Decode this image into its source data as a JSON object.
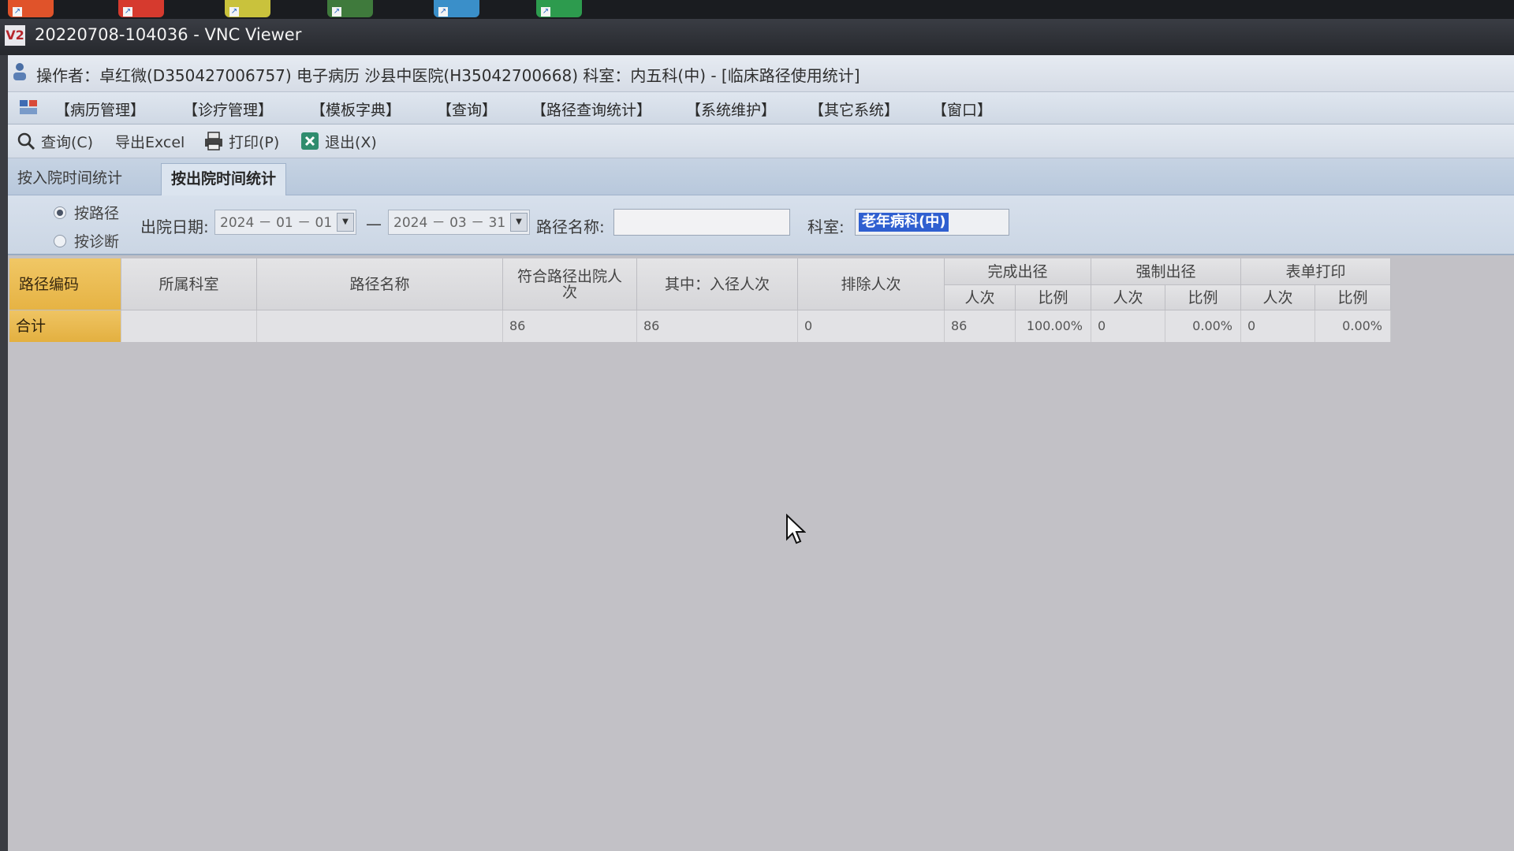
{
  "vnc": {
    "title": "20220708-104036 - VNC Viewer",
    "logo": "V2"
  },
  "info": {
    "text": "操作者：卓红微(D350427006757) 电子病历 沙县中医院(H35042700668) 科室：内五科(中) - [临床路径使用统计]"
  },
  "menu": {
    "items": [
      "【病历管理】",
      "【诊疗管理】",
      "【模板字典】",
      "【查询】",
      "【路径查询统计】",
      "【系统维护】",
      "【其它系统】",
      "【窗口】"
    ]
  },
  "toolbar": {
    "query": "查询(C)",
    "export": "导出Excel",
    "print": "打印(P)",
    "exit": "退出(X)"
  },
  "tabs": {
    "admission": "按入院时间统计",
    "discharge": "按出院时间统计"
  },
  "filter": {
    "by_path": "按路径",
    "by_diagnosis": "按诊断",
    "date_label": "出院日期:",
    "date_from": "2024 － 01 － 01",
    "dash": "—",
    "date_to": "2024 － 03 － 31",
    "path_name_label": "路径名称:",
    "path_name_value": "",
    "dept_label": "科室:",
    "dept_value": "老年病科(中)"
  },
  "table": {
    "headers": {
      "code": "路径编码",
      "dept": "所属科室",
      "name": "路径名称",
      "eligible": "符合路径出院人次",
      "entered": "其中：入径人次",
      "excluded": "排除人次",
      "completed": "完成出径",
      "forced": "强制出径",
      "form_print": "表单打印",
      "count": "人次",
      "ratio": "比例"
    },
    "total_row": {
      "label": "合计",
      "dept": "",
      "name": "",
      "eligible": "86",
      "entered": "86",
      "excluded": "0",
      "completed_count": "86",
      "completed_ratio": "100.00%",
      "forced_count": "0",
      "forced_ratio": "0.00%",
      "print_count": "0",
      "print_ratio": "0.00%"
    }
  },
  "colors": {
    "accent_header": "#e6b344",
    "selection": "#2f5fd0"
  }
}
